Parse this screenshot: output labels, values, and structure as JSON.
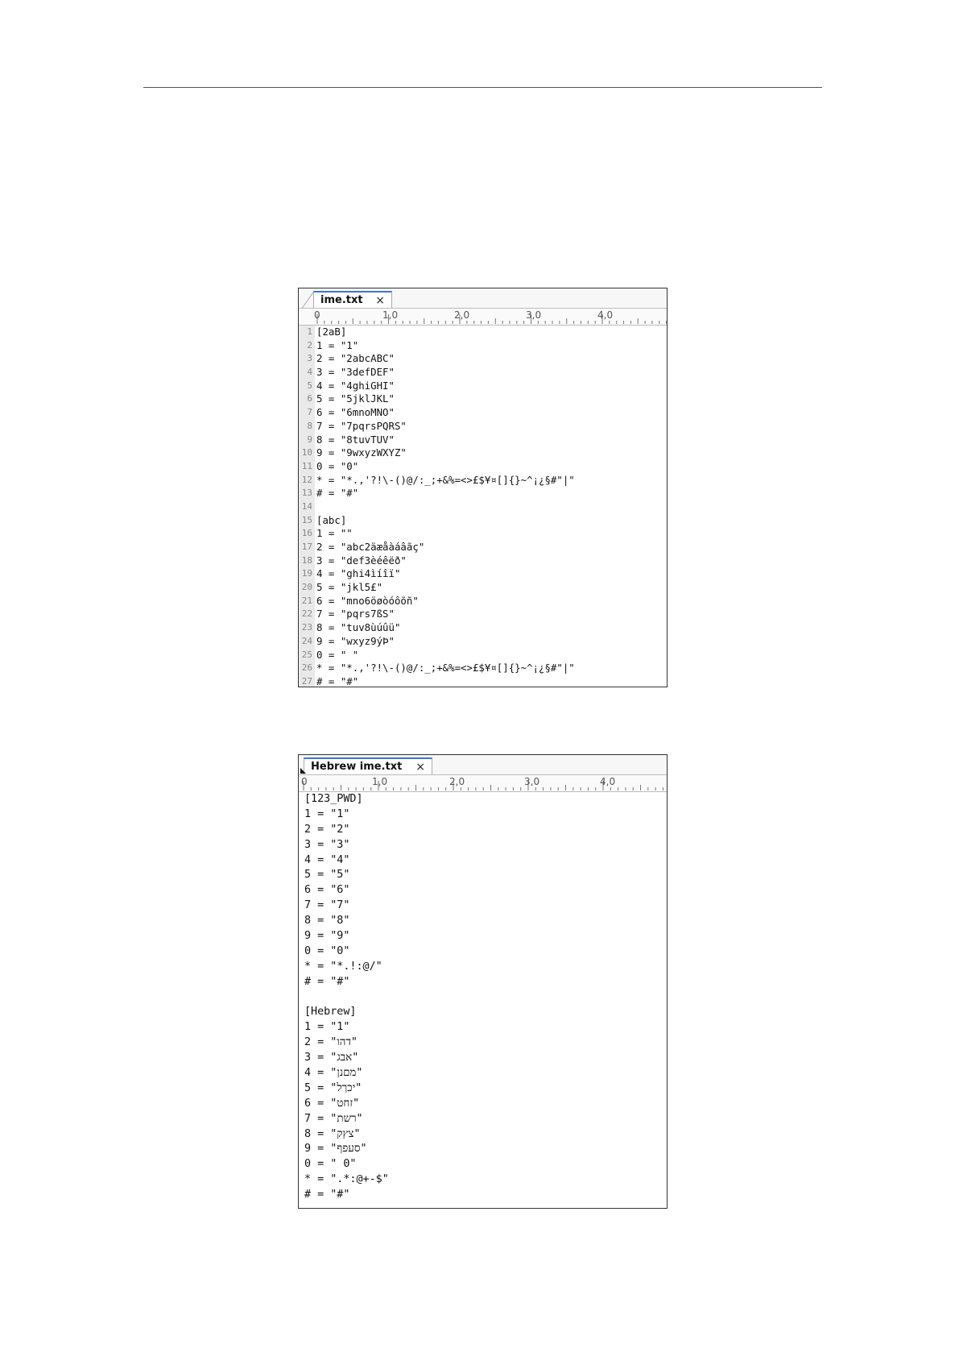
{
  "editor1": {
    "tab_title": "ime.txt",
    "tab_close": "×",
    "ruler_labels": [
      "0",
      "1,0",
      "2,0",
      "3,0",
      "4,0"
    ],
    "lines": [
      {
        "num": "1",
        "text": "[2aB]"
      },
      {
        "num": "2",
        "text": "1 = \"1\""
      },
      {
        "num": "3",
        "text": "2 = \"2abcABC\""
      },
      {
        "num": "4",
        "text": "3 = \"3defDEF\""
      },
      {
        "num": "5",
        "text": "4 = \"4ghiGHI\""
      },
      {
        "num": "6",
        "text": "5 = \"5jklJKL\""
      },
      {
        "num": "7",
        "text": "6 = \"6mnoMNO\""
      },
      {
        "num": "8",
        "text": "7 = \"7pqrsPQRS\""
      },
      {
        "num": "9",
        "text": "8 = \"8tuvTUV\""
      },
      {
        "num": "10",
        "text": "9 = \"9wxyzWXYZ\""
      },
      {
        "num": "11",
        "text": "0 = \"0\""
      },
      {
        "num": "12",
        "text": "* = \"*.,'?!\\-()@/:_;+&%=<>£$¥¤[]{}~^¡¿§#\"|\""
      },
      {
        "num": "13",
        "text": "# = \"#\""
      },
      {
        "num": "14",
        "text": ""
      },
      {
        "num": "15",
        "text": "[abc]"
      },
      {
        "num": "16",
        "text": "1 = \"\""
      },
      {
        "num": "17",
        "text": "2 = \"abc2äæåàáâãç\""
      },
      {
        "num": "18",
        "text": "3 = \"def3èéêëð\""
      },
      {
        "num": "19",
        "text": "4 = \"ghi4ìíîï\""
      },
      {
        "num": "20",
        "text": "5 = \"jkl5£\""
      },
      {
        "num": "21",
        "text": "6 = \"mno6öøòóôõñ\""
      },
      {
        "num": "22",
        "text": "7 = \"pqrs7ßS\""
      },
      {
        "num": "23",
        "text": "8 = \"tuv8ùúûü\""
      },
      {
        "num": "24",
        "text": "9 = \"wxyz9ýÞ\""
      },
      {
        "num": "25",
        "text": "0 = \" \""
      },
      {
        "num": "26",
        "text": "* = \"*.,'?!\\-()@/:_;+&%=<>£$¥¤[]{}~^¡¿§#\"|\""
      },
      {
        "num": "27",
        "text": "# = \"#\""
      }
    ]
  },
  "editor2": {
    "tab_title": "Hebrew ime.txt",
    "tab_close": "×",
    "ruler_labels": [
      "0",
      "1,0",
      "2,0",
      "3,0",
      "4,0"
    ],
    "lines": [
      "[123_PWD]",
      "1 = \"1\"",
      "2 = \"2\"",
      "3 = \"3\"",
      "4 = \"4\"",
      "5 = \"5\"",
      "6 = \"6\"",
      "7 = \"7\"",
      "8 = \"8\"",
      "9 = \"9\"",
      "0 = \"0\"",
      "* = \"*.!:@/\"",
      "# = \"#\"",
      "",
      "[Hebrew]",
      "1 = \"1\"",
      "2 = \"דהו\"",
      "3 = \"אבג\"",
      "4 = \"מםנן\"",
      "5 = \"יכךל\"",
      "6 = \"זחט\"",
      "7 = \"רשת\"",
      "8 = \"צץק\"",
      "9 = \"סעפף\"",
      "0 = \" 0\"",
      "* = \".*:@+-$\"",
      "# = \"#\""
    ]
  }
}
